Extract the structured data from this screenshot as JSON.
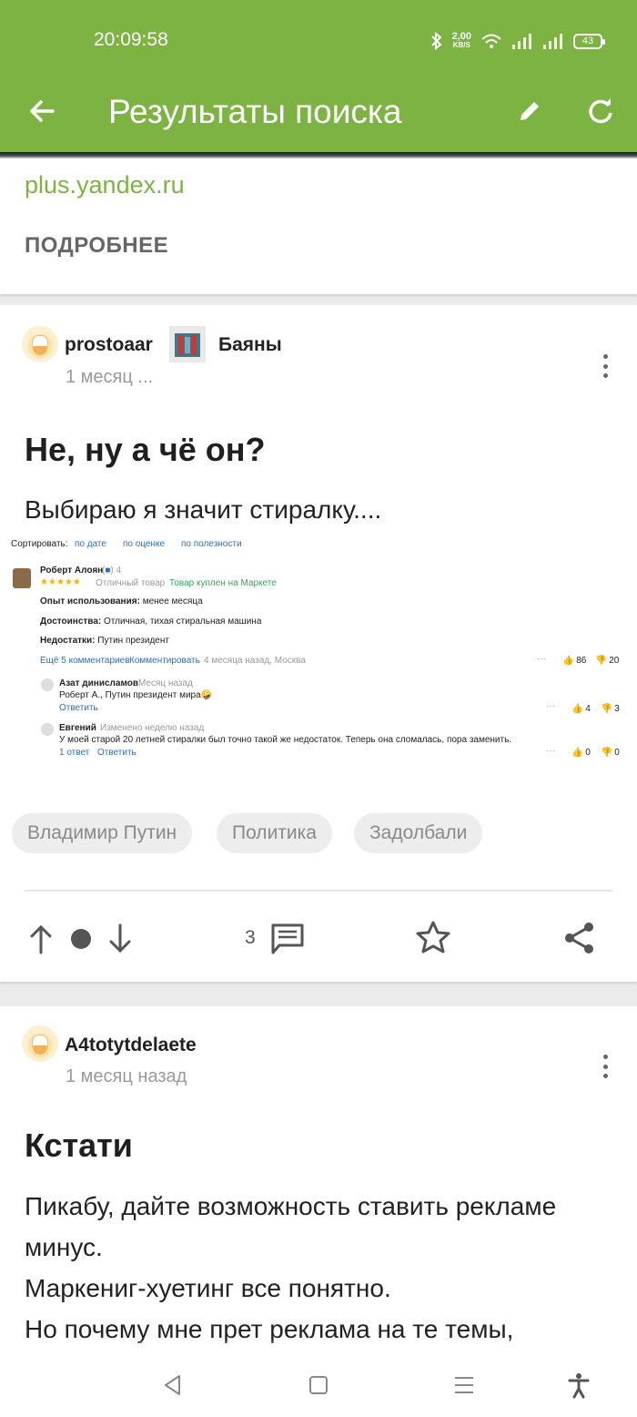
{
  "status_bar": {
    "time": "20:09:58",
    "speed_value": "2,00",
    "speed_unit": "KB/S",
    "battery": "43"
  },
  "app_bar": {
    "title": "Результаты поиска"
  },
  "ad": {
    "link": "plus.yandex.ru",
    "more": "ПОДРОБНЕЕ"
  },
  "post1": {
    "author": "prostoaar",
    "community": "Баяны",
    "date": "1 месяц ...",
    "title": "Не, ну а чё он?",
    "text": "Выбираю я значит стиралку....",
    "screenshot": {
      "sort_label": "Сортировать:",
      "sort_date": "по дате",
      "sort_rating": "по оценке",
      "sort_useful": "по полезности",
      "reviewer": "Роберт Алоян",
      "reviewer_rating": "4",
      "stars": "★★★★★",
      "verdict": "Отличный товар",
      "bought": "Товар куплен на Маркете",
      "usage_label": "Опыт использования:",
      "usage_value": "менее месяца",
      "pros_label": "Достоинства:",
      "pros_value": "Отличная, тихая стиральная машина",
      "cons_label": "Недостатки:",
      "cons_value": "Путин президент",
      "show_comments": "Ещё 5 комментариев",
      "comment_action": "Комментировать",
      "meta": "4 месяца назад, Москва",
      "likes": "86",
      "dislikes": "20",
      "c1_author": "Азат динисламов",
      "c1_date": "Месяц назад",
      "c1_text": "Роберт А., Путин президент мира🤪",
      "c1_reply": "Ответить",
      "c1_likes": "4",
      "c1_dislikes": "3",
      "c2_author": "Евгений",
      "c2_date": "Изменено неделю назад",
      "c2_text": "У моей старой 20 летней стиралки был точно такой же недостаток. Теперь она сломалась, пора заменить.",
      "c2_replies": "1 ответ",
      "c2_reply": "Ответить",
      "c2_likes": "0",
      "c2_dislikes": "0"
    },
    "tags": [
      "Владимир Путин",
      "Политика",
      "Задолбали"
    ],
    "comments_count": "3"
  },
  "post2": {
    "author": "A4totytdelaete",
    "date": "1 месяц назад",
    "title": "Кстати",
    "lines": [
      "Пикабу, дайте возможность ставить рекламе",
      "минус.",
      "Маркениг-хуетинг все понятно.",
      "Но почему мне прет реклама на те темы,"
    ]
  },
  "colors": {
    "brand": "#7cb342",
    "link_blue": "#2b6fbf"
  }
}
